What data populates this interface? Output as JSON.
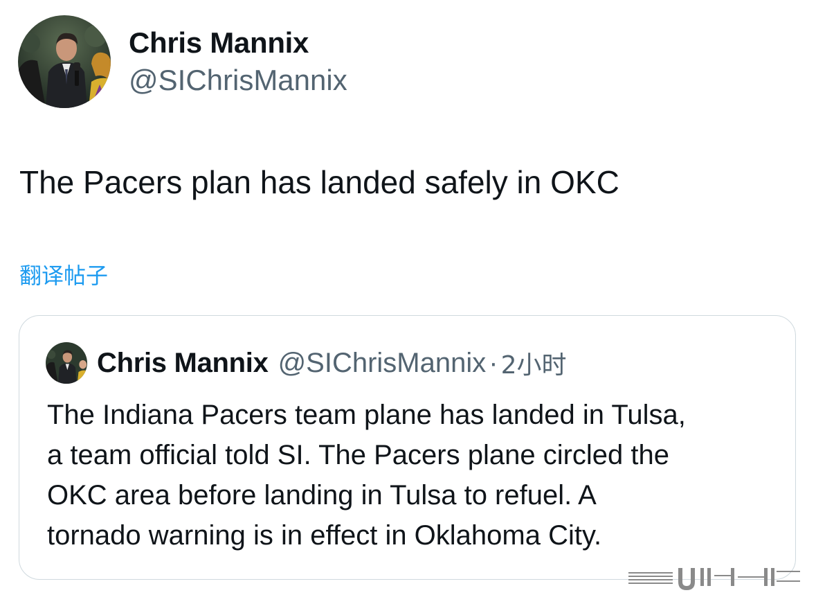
{
  "author": {
    "display_name": "Chris Mannix",
    "handle": "@SIChrisMannix"
  },
  "tweet": {
    "text": "The Pacers plan has landed safely in OKC",
    "translate_label": "翻译帖子"
  },
  "quoted_tweet": {
    "author_name": "Chris Mannix",
    "handle": "@SIChrisMannix",
    "separator": "·",
    "time": "2小时",
    "text_lines": [
      "The Indiana Pacers team plane has landed in Tulsa,",
      "a team official told SI. The Pacers plane circled the",
      "OKC area before landing in Tulsa to refuel. A",
      "tornado warning is in effect in Oklahoma City."
    ]
  },
  "colors": {
    "text_primary": "#0f1419",
    "text_secondary": "#536471",
    "link": "#1d9bf0",
    "card_border": "#cfd9de"
  },
  "icons": {
    "avatar": "profile-photo",
    "watermark": "site-watermark"
  }
}
